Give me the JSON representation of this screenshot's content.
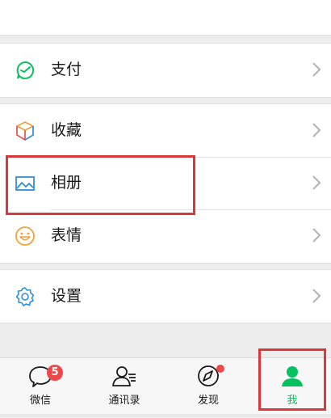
{
  "menu": {
    "pay": {
      "label": "支付",
      "icon": "pay-check-icon"
    },
    "favorites": {
      "label": "收藏",
      "icon": "cube-icon"
    },
    "album": {
      "label": "相册",
      "icon": "image-icon"
    },
    "stickers": {
      "label": "表情",
      "icon": "smiley-icon"
    },
    "settings": {
      "label": "设置",
      "icon": "gear-icon"
    }
  },
  "tabbar": {
    "chats": {
      "label": "微信",
      "icon": "chat-bubble-icon",
      "badge": "5"
    },
    "contacts": {
      "label": "通讯录",
      "icon": "contacts-icon"
    },
    "discover": {
      "label": "发现",
      "icon": "compass-icon"
    },
    "me": {
      "label": "我",
      "icon": "person-icon",
      "active": true
    }
  },
  "colors": {
    "accent_green": "#07c160",
    "badge_red": "#f0484a",
    "highlight_red": "#d9383b"
  }
}
